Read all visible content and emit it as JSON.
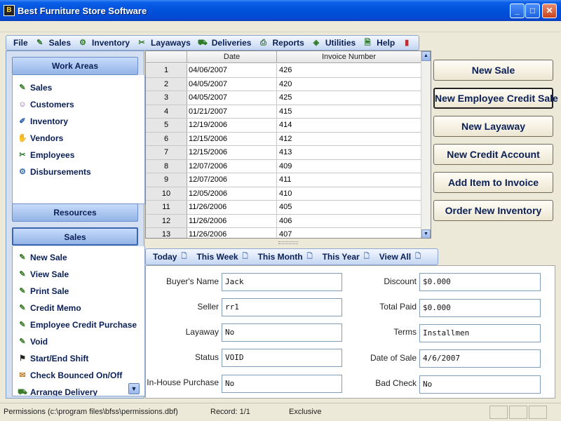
{
  "window": {
    "title": "Best Furniture Store Software",
    "icon_text": "B"
  },
  "menu": [
    {
      "label": "File",
      "icon": ""
    },
    {
      "label": "Sales",
      "icon": "pen-icon"
    },
    {
      "label": "Inventory",
      "icon": "gear-icon"
    },
    {
      "label": "Layaways",
      "icon": "scissors-icon"
    },
    {
      "label": "Deliveries",
      "icon": "truck-icon"
    },
    {
      "label": "Reports",
      "icon": "printer-icon"
    },
    {
      "label": "Utilities",
      "icon": "tag-icon"
    },
    {
      "label": "Help",
      "icon": "document-icon"
    }
  ],
  "work_areas": {
    "header": "Work Areas",
    "items": [
      "Sales",
      "Customers",
      "Inventory",
      "Vendors",
      "Employees",
      "Disbursements"
    ]
  },
  "resources": {
    "header": "Resources"
  },
  "sales_panel": {
    "header": "Sales",
    "items": [
      "New Sale",
      "View Sale",
      "Print Sale",
      "Credit Memo",
      "Employee Credit Purchase",
      "Void",
      "Start/End Shift",
      "Check Bounced On/Off",
      "Arrange Delivery"
    ]
  },
  "grid": {
    "columns": [
      "Date",
      "Invoice Number"
    ],
    "rows": [
      {
        "num": "1",
        "date": "04/06/2007",
        "invoice": "426"
      },
      {
        "num": "2",
        "date": "04/05/2007",
        "invoice": "420"
      },
      {
        "num": "3",
        "date": "04/05/2007",
        "invoice": "425"
      },
      {
        "num": "4",
        "date": "01/21/2007",
        "invoice": "415"
      },
      {
        "num": "5",
        "date": "12/19/2006",
        "invoice": "414"
      },
      {
        "num": "6",
        "date": "12/15/2006",
        "invoice": "412"
      },
      {
        "num": "7",
        "date": "12/15/2006",
        "invoice": "413"
      },
      {
        "num": "8",
        "date": "12/07/2006",
        "invoice": "409"
      },
      {
        "num": "9",
        "date": "12/07/2006",
        "invoice": "411"
      },
      {
        "num": "10",
        "date": "12/05/2006",
        "invoice": "410"
      },
      {
        "num": "11",
        "date": "11/26/2006",
        "invoice": "405"
      },
      {
        "num": "12",
        "date": "11/26/2006",
        "invoice": "406"
      },
      {
        "num": "13",
        "date": "11/26/2006",
        "invoice": "407"
      }
    ]
  },
  "actions": [
    "New Sale",
    "New Employee Credit Sale",
    "New Layaway",
    "New Credit Account",
    "Add Item to Invoice",
    "Order New Inventory"
  ],
  "filters": [
    "Today",
    "This Week",
    "This Month",
    "This Year",
    "View All"
  ],
  "details": {
    "buyers_name": {
      "label": "Buyer's Name",
      "value": "Jack"
    },
    "seller": {
      "label": "Seller",
      "value": "rr1"
    },
    "layaway": {
      "label": "Layaway",
      "value": "No"
    },
    "status": {
      "label": "Status",
      "value": "VOID"
    },
    "in_house_purchase": {
      "label": "In-House Purchase",
      "value": "No"
    },
    "discount": {
      "label": "Discount",
      "value": "$0.000"
    },
    "total_paid": {
      "label": "Total Paid",
      "value": "$0.000"
    },
    "terms": {
      "label": "Terms",
      "value": "Installmen"
    },
    "date_of_sale": {
      "label": "Date of Sale",
      "value": "4/6/2007"
    },
    "bad_check": {
      "label": "Bad Check",
      "value": "No"
    }
  },
  "status_bar": {
    "permissions": "Permissions (c:\\program files\\bfss\\permissions.dbf)",
    "record": "Record: 1/1",
    "mode": "Exclusive"
  }
}
